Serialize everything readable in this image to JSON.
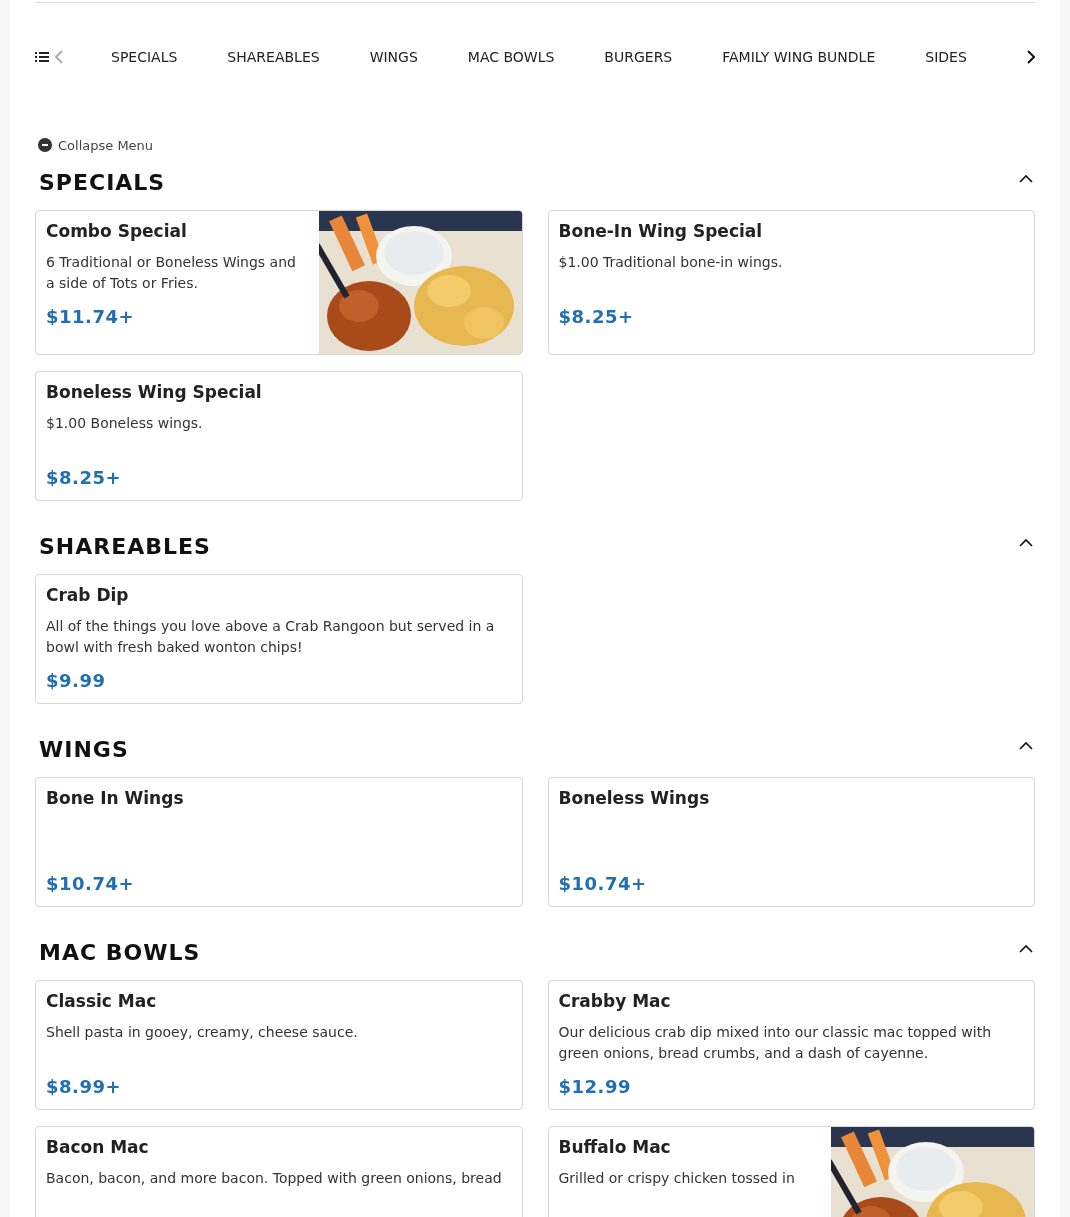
{
  "nav": {
    "tabs": [
      "SPECIALS",
      "SHAREABLES",
      "WINGS",
      "MAC BOWLS",
      "BURGERS",
      "FAMILY WING BUNDLE",
      "SIDES"
    ]
  },
  "collapse": {
    "label": "Collapse Menu"
  },
  "sections": [
    {
      "title": "SPECIALS",
      "expanded": true,
      "items": [
        {
          "name": "Combo Special",
          "description": "6 Traditional or Boneless Wings and a side of Tots or Fries.",
          "price": "$11.74+"
        },
        {
          "name": "Bone-In Wing Special",
          "description": "$1.00 Traditional bone-in wings.",
          "price": "$8.25+"
        },
        {
          "name": "Boneless Wing Special",
          "description": "$1.00 Boneless wings.",
          "price": "$8.25+"
        }
      ]
    },
    {
      "title": "SHAREABLES",
      "expanded": true,
      "items": [
        {
          "name": "Crab Dip",
          "description": "All of the things you love above a Crab Rangoon but served in a bowl with fresh baked wonton chips!",
          "price": "$9.99"
        }
      ]
    },
    {
      "title": "WINGS",
      "expanded": true,
      "items": [
        {
          "name": "Bone In Wings",
          "price": "$10.74+"
        },
        {
          "name": "Boneless Wings",
          "price": "$10.74+"
        }
      ]
    },
    {
      "title": "MAC BOWLS",
      "expanded": true,
      "items": [
        {
          "name": "Classic Mac",
          "description": "Shell pasta in gooey, creamy, cheese sauce.",
          "price": "$8.99+"
        },
        {
          "name": "Crabby Mac",
          "description": "Our delicious crab dip mixed into our classic mac topped with green onions, bread crumbs, and a dash of cayenne.",
          "price": "$12.99"
        },
        {
          "name": "Bacon Mac",
          "description": "Bacon, bacon, and more bacon. Topped with green onions, bread"
        },
        {
          "name": "Buffalo Mac",
          "description": "Grilled or crispy chicken tossed in"
        }
      ]
    }
  ]
}
